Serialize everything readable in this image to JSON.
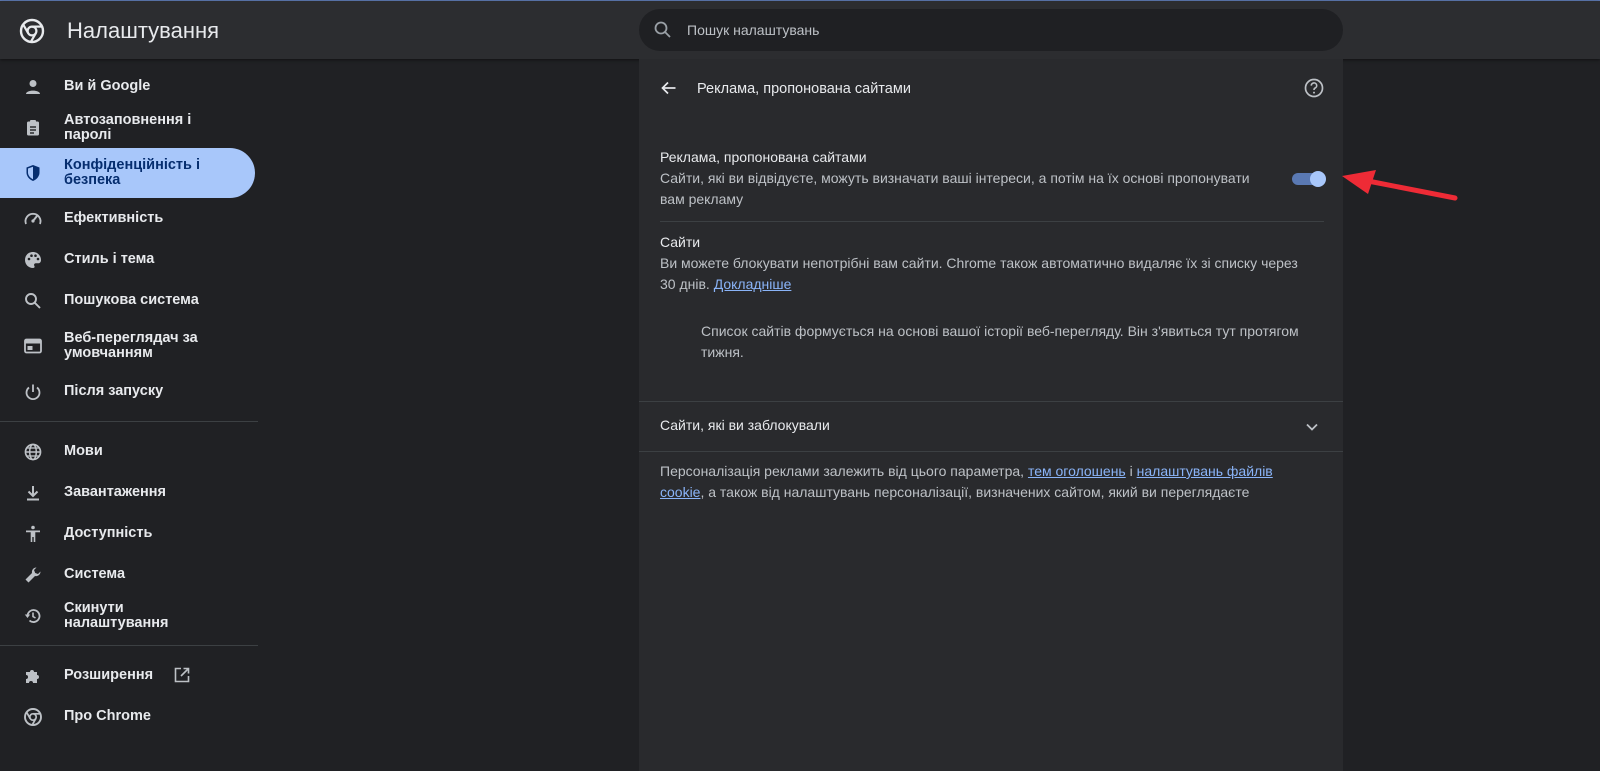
{
  "header": {
    "app_title": "Налаштування",
    "search_placeholder": "Пошук налаштувань"
  },
  "sidebar": {
    "items": [
      {
        "label": "Ви й Google",
        "icon": "person-icon"
      },
      {
        "label": "Автозаповнення і паролі",
        "icon": "clipboard-icon"
      },
      {
        "label": "Конфіденційність і безпека",
        "icon": "shield-icon",
        "active": true
      },
      {
        "label": "Ефективність",
        "icon": "speedometer-icon"
      },
      {
        "label": "Стиль і тема",
        "icon": "palette-icon"
      },
      {
        "label": "Пошукова система",
        "icon": "search-icon"
      },
      {
        "label": "Веб-переглядач за умовчанням",
        "icon": "browser-icon"
      },
      {
        "label": "Після запуску",
        "icon": "power-icon"
      },
      {
        "label": "Мови",
        "icon": "globe-icon"
      },
      {
        "label": "Завантаження",
        "icon": "download-icon"
      },
      {
        "label": "Доступність",
        "icon": "accessibility-icon"
      },
      {
        "label": "Система",
        "icon": "wrench-icon"
      },
      {
        "label": "Скинути налаштування",
        "icon": "restore-icon"
      },
      {
        "label": "Розширення",
        "icon": "puzzle-icon"
      },
      {
        "label": "Про Chrome",
        "icon": "chrome-icon"
      }
    ]
  },
  "panel": {
    "title": "Реклама, пропонована сайтами",
    "setting_title": "Реклама, пропонована сайтами",
    "setting_desc": "Сайти, які ви відвідуєте, можуть визначати ваші інтереси, а потім на їх основі пропонувати вам рекламу",
    "toggle_on": true,
    "sites_title": "Сайти",
    "sites_desc": "Ви можете блокувати непотрібні вам сайти. Chrome також автоматично видаляє їх зі списку через 30 днів.",
    "learn_more": "Докладніше",
    "sites_empty": "Список сайтів формується на основі вашої історії веб-перегляду. Він з'явиться тут протягом тижня.",
    "blocked_label": "Сайти, які ви заблокували",
    "footer_text_1": "Персоналізація реклами залежить від цього параметра,",
    "footer_link_1": "тем оголошень",
    "footer_text_2": "і",
    "footer_link_2": "налаштувань файлів cookie",
    "footer_text_3": ", а також від налаштувань персоналізації, визначених сайтом, який ви переглядаєте"
  },
  "colors": {
    "accent": "#a8c7fa",
    "link": "#8ab4f8",
    "annotation_arrow": "#ee2b36"
  }
}
